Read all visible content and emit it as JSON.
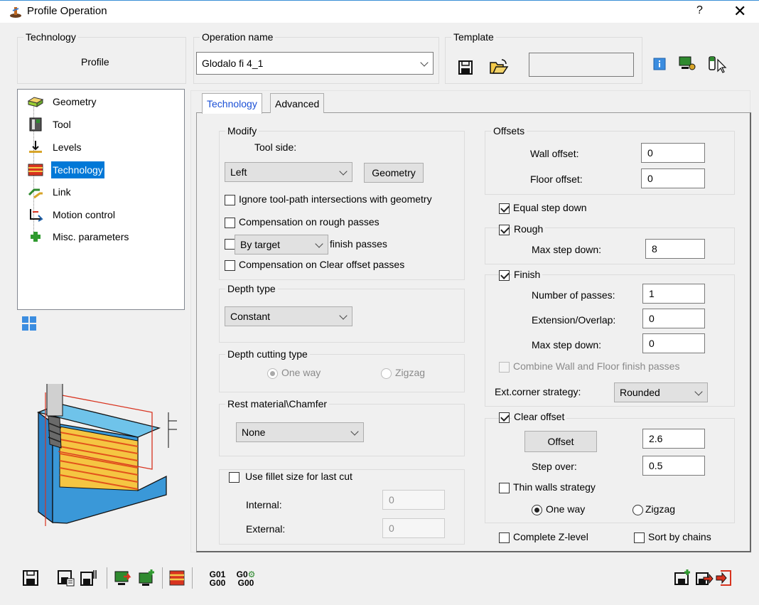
{
  "window": {
    "title": "Profile Operation",
    "help": "?",
    "close": "✕"
  },
  "technology": {
    "legend": "Technology",
    "value": "Profile"
  },
  "operation": {
    "legend": "Operation name",
    "value": "Glodalo fi 4_1"
  },
  "template": {
    "legend": "Template"
  },
  "tree": {
    "items": [
      {
        "label": "Geometry",
        "icon": "geometry-icon"
      },
      {
        "label": "Tool",
        "icon": "tool-icon"
      },
      {
        "label": "Levels",
        "icon": "levels-icon"
      },
      {
        "label": "Technology",
        "icon": "technology-icon",
        "selected": true
      },
      {
        "label": "Link",
        "icon": "link-icon"
      },
      {
        "label": "Motion control",
        "icon": "motion-control-icon"
      },
      {
        "label": "Misc. parameters",
        "icon": "misc-parameters-icon"
      }
    ]
  },
  "tabs": {
    "technology": "Technology",
    "advanced": "Advanced"
  },
  "modify": {
    "legend": "Modify",
    "tool_side_label": "Tool side:",
    "tool_side_value": "Left",
    "geometry_button": "Geometry",
    "ignore_intersections": "Ignore tool-path intersections with geometry",
    "comp_rough": "Compensation on rough passes",
    "by_target": "By target",
    "finish_passes": "finish passes",
    "comp_clear": "Compensation on Clear offset passes"
  },
  "depth_type": {
    "legend": "Depth type",
    "value": "Constant"
  },
  "depth_cutting": {
    "legend": "Depth cutting type",
    "one_way": "One way",
    "zigzag": "Zigzag"
  },
  "rest_material": {
    "legend": "Rest material\\Chamfer",
    "value": "None"
  },
  "fillet": {
    "label": "Use fillet size for last cut",
    "internal_label": "Internal:",
    "internal_value": "0",
    "external_label": "External:",
    "external_value": "0"
  },
  "offsets": {
    "legend": "Offsets",
    "wall_label": "Wall offset:",
    "wall_value": "0",
    "floor_label": "Floor offset:",
    "floor_value": "0"
  },
  "equal_step": "Equal step down",
  "rough": {
    "label": "Rough",
    "max_step_label": "Max step down:",
    "max_step_value": "8"
  },
  "finish": {
    "label": "Finish",
    "passes_label": "Number of passes:",
    "passes_value": "1",
    "ext_label": "Extension/Overlap:",
    "ext_value": "0",
    "max_step_label": "Max step down:",
    "max_step_value": "0",
    "combine": "Combine Wall and Floor finish passes",
    "corner_label": "Ext.corner strategy:",
    "corner_value": "Rounded"
  },
  "clear_offset": {
    "label": "Clear offset",
    "offset_button": "Offset",
    "offset_value": "2.6",
    "step_over_label": "Step over:",
    "step_over_value": "0.5",
    "thin_walls": "Thin walls strategy",
    "one_way": "One way",
    "zigzag": "Zigzag"
  },
  "complete_z": "Complete Z-level",
  "sort_chains": "Sort by chains",
  "gcode": {
    "g01": "G01",
    "g00": "G00",
    "g0": "G0"
  }
}
